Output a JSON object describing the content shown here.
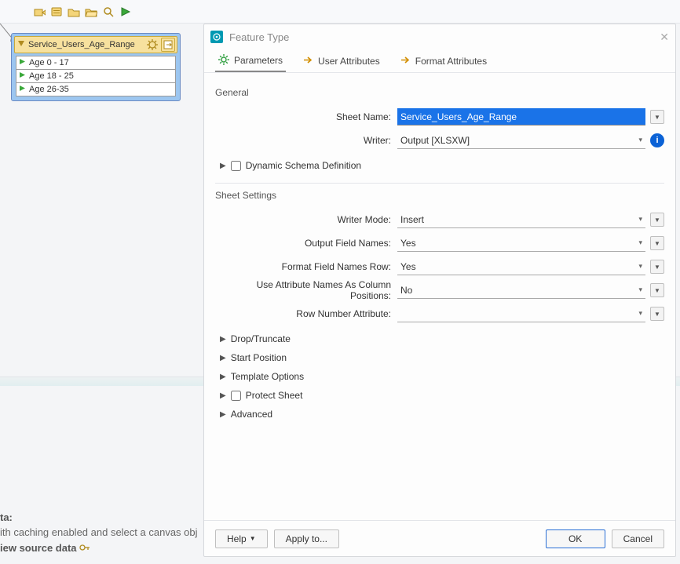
{
  "dialog": {
    "title": "Feature Type",
    "tabs": {
      "parameters": "Parameters",
      "user_attributes": "User Attributes",
      "format_attributes": "Format Attributes"
    },
    "general": {
      "heading": "General",
      "sheet_name_label": "Sheet Name:",
      "sheet_name_value": "Service_Users_Age_Range",
      "writer_label": "Writer:",
      "writer_value": "Output [XLSXW]",
      "dynamic_schema": "Dynamic Schema Definition"
    },
    "sheet_settings": {
      "heading": "Sheet Settings",
      "writer_mode_label": "Writer Mode:",
      "writer_mode_value": "Insert",
      "output_field_names_label": "Output Field Names:",
      "output_field_names_value": "Yes",
      "format_field_names_label": "Format Field Names Row:",
      "format_field_names_value": "Yes",
      "attr_names_col_label": "Use Attribute Names As Column Positions:",
      "attr_names_col_value": "No",
      "row_number_attr_label": "Row Number Attribute:",
      "row_number_attr_value": "",
      "drop_truncate": "Drop/Truncate",
      "start_position": "Start Position",
      "template_options": "Template Options",
      "protect_sheet": "Protect Sheet",
      "advanced": "Advanced"
    },
    "footer": {
      "help": "Help",
      "apply_to": "Apply to...",
      "ok": "OK",
      "cancel": "Cancel"
    }
  },
  "canvas": {
    "node_title": "Service_Users_Age_Range",
    "rows": [
      "Age 0 - 17",
      "Age 18 - 25",
      "Age 26-35"
    ]
  },
  "hint": {
    "line1": "ta:",
    "line2": "ith caching enabled and select a canvas obj",
    "line3": "iew source data"
  }
}
